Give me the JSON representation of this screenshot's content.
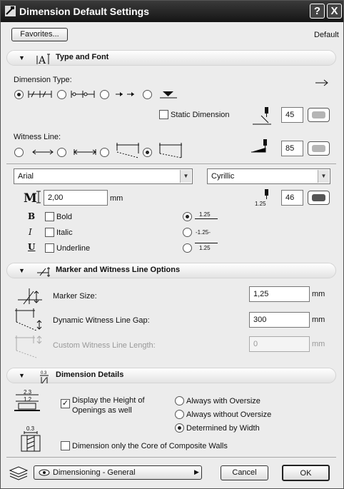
{
  "window": {
    "title": "Dimension Default Settings",
    "help_button": "?",
    "close_button": "X"
  },
  "top": {
    "favorites_label": "Favorites...",
    "default_label": "Default"
  },
  "sec_type": {
    "title": "Type and Font"
  },
  "dimension_type": {
    "label": "Dimension Type:",
    "selected_index": 0,
    "static_label": "Static Dimension",
    "static_checked": false,
    "pen_value": "45"
  },
  "witness": {
    "label": "Witness Line:",
    "selected_index": 3,
    "pen_value": "85"
  },
  "font": {
    "family": "Arial",
    "script": "Cyrillic",
    "size": "2,00",
    "unit": "mm",
    "pen_value": "46",
    "pen_prefix": "1.25"
  },
  "styles": {
    "bold_label": "Bold",
    "italic_label": "Italic",
    "underline_label": "Underline",
    "bold_glyph": "B",
    "italic_glyph": "I",
    "underline_glyph": "U"
  },
  "text_pos": {
    "opt1": "1.25",
    "opt2": "-1.25-",
    "opt3": "1.25",
    "selected_index": 0
  },
  "sec_marker": {
    "title": "Marker and Witness Line Options"
  },
  "marker": {
    "size_label": "Marker Size:",
    "size_value": "1,25",
    "gap_label": "Dynamic Witness Line Gap:",
    "gap_value": "300",
    "custom_label": "Custom Witness Line Length:",
    "custom_value": "0",
    "unit": "mm"
  },
  "sec_details": {
    "title": "Dimension Details"
  },
  "details": {
    "icon_top": "2.3",
    "icon_bottom": "1.2",
    "icon_core": "0.3",
    "display_height_label": "Display the Height of Openings as well",
    "display_height_line1": "Display the Height of",
    "display_height_line2": "Openings as well",
    "display_height_checked": true,
    "oversize_options": [
      "Always with Oversize",
      "Always without Oversize",
      "Determined by Width"
    ],
    "oversize_selected": 2,
    "core_label": "Dimension only the Core of Composite Walls",
    "core_checked": false
  },
  "footer": {
    "layer_label": "Dimensioning - General",
    "cancel_label": "Cancel",
    "ok_label": "OK"
  },
  "colors": {
    "title_bar": "#1c1c1c",
    "pen_dark": "#555555",
    "pen_light": "#b5b5b5"
  }
}
